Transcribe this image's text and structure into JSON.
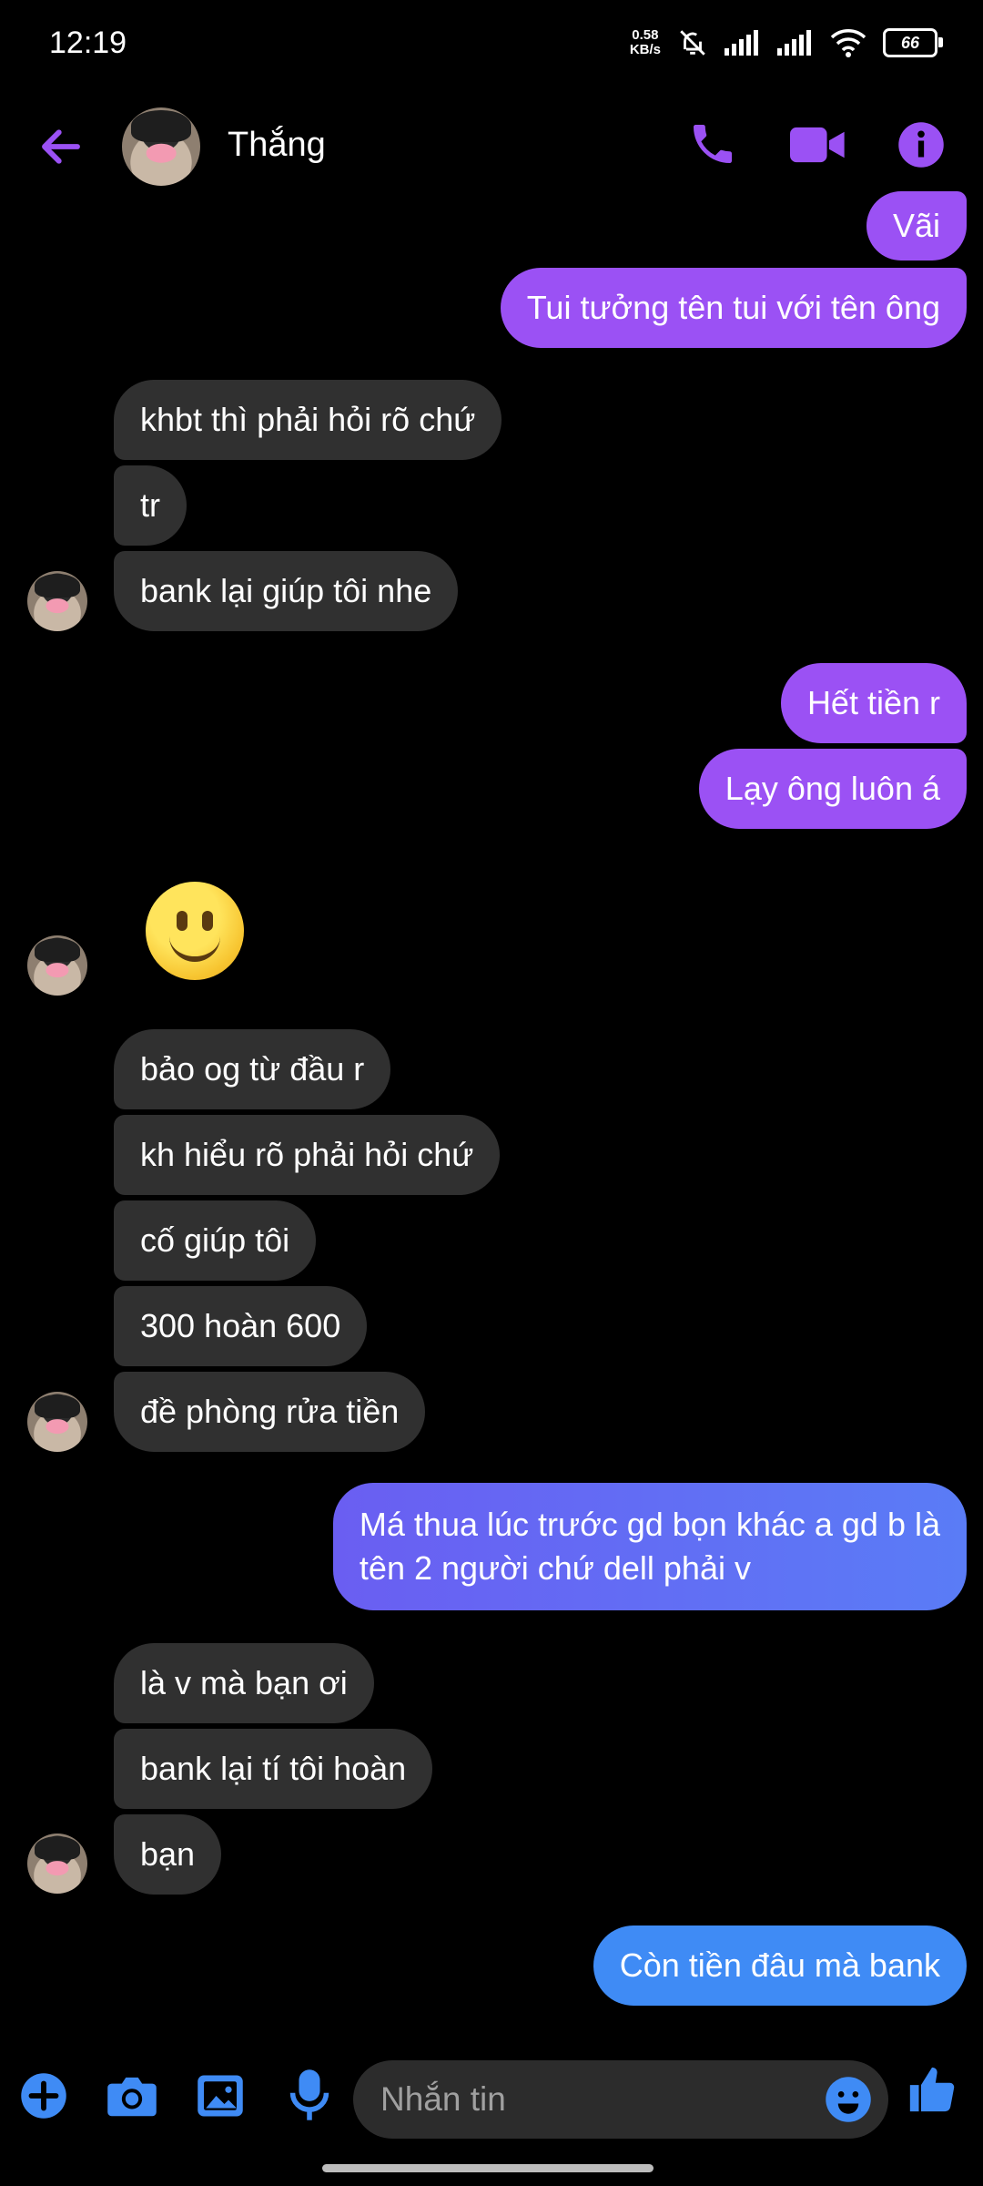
{
  "status": {
    "time": "12:19",
    "net_value": "0.58",
    "net_unit": "KB/s",
    "battery": "66"
  },
  "header": {
    "contact_name": "Thắng"
  },
  "colors": {
    "accent": "#9b51f4",
    "incoming": "#303030",
    "outgoing_purple": "#9b51f4",
    "outgoing_blue": "#3f8bf5"
  },
  "messages": [
    {
      "text": "Vãi"
    },
    {
      "text": "Tui tưởng tên tui với tên ông"
    },
    {
      "text": "khbt thì phải hỏi rõ chứ"
    },
    {
      "text": "tr"
    },
    {
      "text": "bank lại giúp tôi nhe"
    },
    {
      "text": "Hết tiền r"
    },
    {
      "text": "Lạy ông luôn á"
    },
    {
      "text": "bảo og từ đầu r"
    },
    {
      "text": "kh hiểu rõ phải hỏi chứ"
    },
    {
      "text": "cố giúp tôi"
    },
    {
      "text": "300 hoàn 600"
    },
    {
      "text": "đề phòng rửa tiền"
    },
    {
      "line1": "Má thua lúc trước gd bọn khác a gd b là",
      "line2": "tên 2 người chứ dell phải v"
    },
    {
      "text": "là v mà bạn ơi"
    },
    {
      "text": "bank lại tí tôi hoàn"
    },
    {
      "text": "bạn"
    },
    {
      "text": "Còn tiền đâu mà bank"
    }
  ],
  "composer": {
    "placeholder": "Nhắn tin"
  },
  "icons": [
    "back-arrow-icon",
    "phone-icon",
    "video-camera-icon",
    "info-icon",
    "plus-icon",
    "camera-icon",
    "gallery-icon",
    "microphone-icon",
    "emoji-icon",
    "thumbs-up-icon"
  ]
}
